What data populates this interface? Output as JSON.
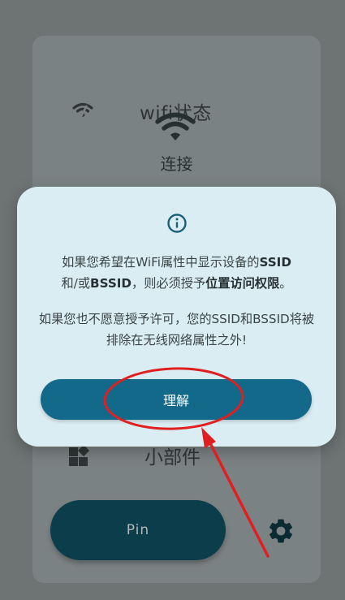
{
  "background": {
    "wifi_status_title": "wifi状态",
    "connection_text": "连接",
    "widget_label": "小部件",
    "pin_button_label": "Pin"
  },
  "dialog": {
    "message1_part1": "如果您希望在WiFi属性中显示设备的",
    "message1_ssid": "SSID",
    "message1_part2": "和/或",
    "message1_bssid": "BSSID",
    "message1_part3": "，则必须授予",
    "message1_permission": "位置访问权限",
    "message1_end": "。",
    "message2": "如果您也不愿意授予许可，您的SSID和BSSID将被排除在无线网络属性之外!",
    "understand_button_label": "理解"
  },
  "colors": {
    "dialog_bg": "#daedf3",
    "primary_button": "#12698a",
    "annotation_red": "#e02020"
  },
  "icons": {
    "wifi_small": "wifi-icon",
    "wifi_big": "wifi-icon",
    "widgets": "widgets-icon",
    "settings": "gear-icon",
    "info": "info-icon"
  }
}
